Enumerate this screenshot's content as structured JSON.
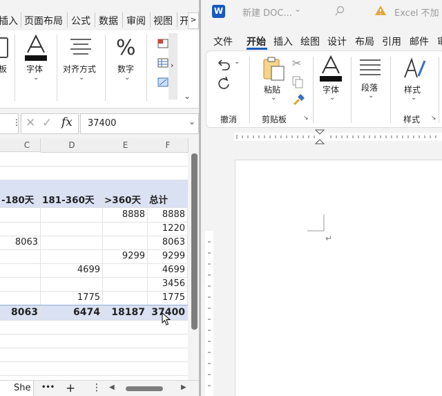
{
  "excel": {
    "tabs": [
      "插入",
      "页面布局",
      "公式",
      "数据",
      "审阅",
      "视图",
      "开"
    ],
    "tab_more": ">",
    "ribbon": {
      "partial_label": "板",
      "font": "字体",
      "align": "对齐方式",
      "number": "数字",
      "more": "›"
    },
    "formula_bar": {
      "value": "37400",
      "fx": "fx",
      "cancel": "✕",
      "enter": "✓"
    },
    "columns": [
      "C",
      "D",
      "E",
      "F"
    ],
    "header_row": [
      "-180天",
      "181-360天",
      ">360天",
      "总计"
    ],
    "rows": [
      [
        "",
        "",
        "8888",
        "8888"
      ],
      [
        "",
        "",
        "",
        "1220"
      ],
      [
        "8063",
        "",
        "",
        "8063"
      ],
      [
        "",
        "",
        "9299",
        "9299"
      ],
      [
        "",
        "4699",
        "",
        "4699"
      ],
      [
        "",
        "",
        "",
        "3456"
      ],
      [
        "",
        "1775",
        "",
        "1775"
      ]
    ],
    "total_row": [
      "8063",
      "6474",
      "18187",
      "37400"
    ],
    "sheet_tab": "She",
    "sheet_more": "•••",
    "sheet_add": "+",
    "sheet_menu": "⋮"
  },
  "word": {
    "title": "新建 DOC...",
    "warning": "Excel 不加",
    "tabs": [
      "文件",
      "开始",
      "插入",
      "绘图",
      "设计",
      "布局",
      "引用",
      "邮件"
    ],
    "active_tab": "开始",
    "groups": {
      "undo": "撤消",
      "clipboard": "剪贴板",
      "paste": "粘贴",
      "font": "字体",
      "paragraph": "段落",
      "styles_btn": "样式",
      "styles": "样式"
    },
    "paragraph_mark": "↵"
  },
  "colors": {
    "header_fill": "#d9e1f2",
    "total_fill": "#d9e1f2",
    "word_blue": "#185abd",
    "warning": "#e8a23b"
  }
}
